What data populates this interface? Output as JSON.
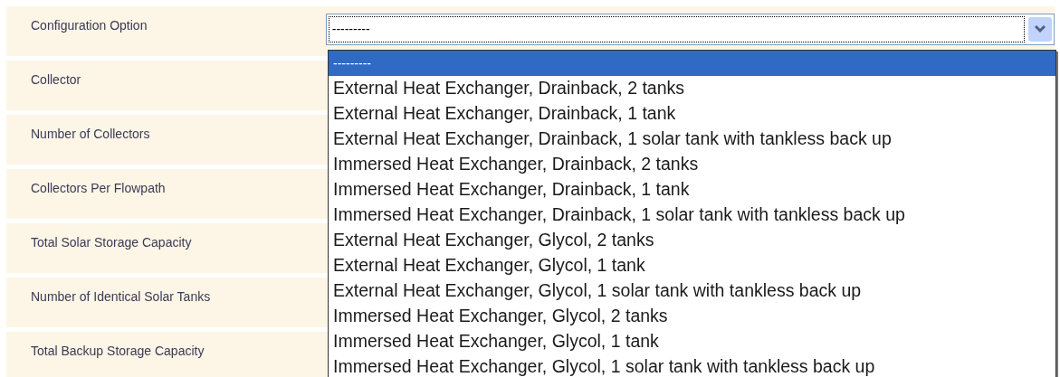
{
  "form_rows": [
    {
      "label": "Configuration Option"
    },
    {
      "label": "Collector"
    },
    {
      "label": "Number of Collectors"
    },
    {
      "label": "Collectors Per Flowpath"
    },
    {
      "label": "Total Solar Storage Capacity"
    },
    {
      "label": "Number of Identical Solar Tanks"
    },
    {
      "label": "Total Backup Storage Capacity"
    }
  ],
  "configuration_select": {
    "value": "---------",
    "expanded": true,
    "options": [
      {
        "label": "---------",
        "selected": true
      },
      {
        "label": "External Heat Exchanger, Drainback, 2 tanks",
        "selected": false
      },
      {
        "label": "External Heat Exchanger, Drainback, 1 tank",
        "selected": false
      },
      {
        "label": "External Heat Exchanger, Drainback, 1 solar tank with tankless back up",
        "selected": false
      },
      {
        "label": "Immersed Heat Exchanger, Drainback, 2 tanks",
        "selected": false
      },
      {
        "label": "Immersed Heat Exchanger, Drainback, 1 tank",
        "selected": false
      },
      {
        "label": "Immersed Heat Exchanger, Drainback, 1 solar tank with tankless back up",
        "selected": false
      },
      {
        "label": "External Heat Exchanger, Glycol, 2 tanks",
        "selected": false
      },
      {
        "label": "External Heat Exchanger, Glycol, 1 tank",
        "selected": false
      },
      {
        "label": "External Heat Exchanger, Glycol, 1 solar tank with tankless back up",
        "selected": false
      },
      {
        "label": "Immersed Heat Exchanger, Glycol, 2 tanks",
        "selected": false
      },
      {
        "label": "Immersed Heat Exchanger, Glycol, 1 tank",
        "selected": false
      },
      {
        "label": "Immersed Heat Exchanger, Glycol, 1 solar tank with tankless back up",
        "selected": false
      }
    ]
  }
}
